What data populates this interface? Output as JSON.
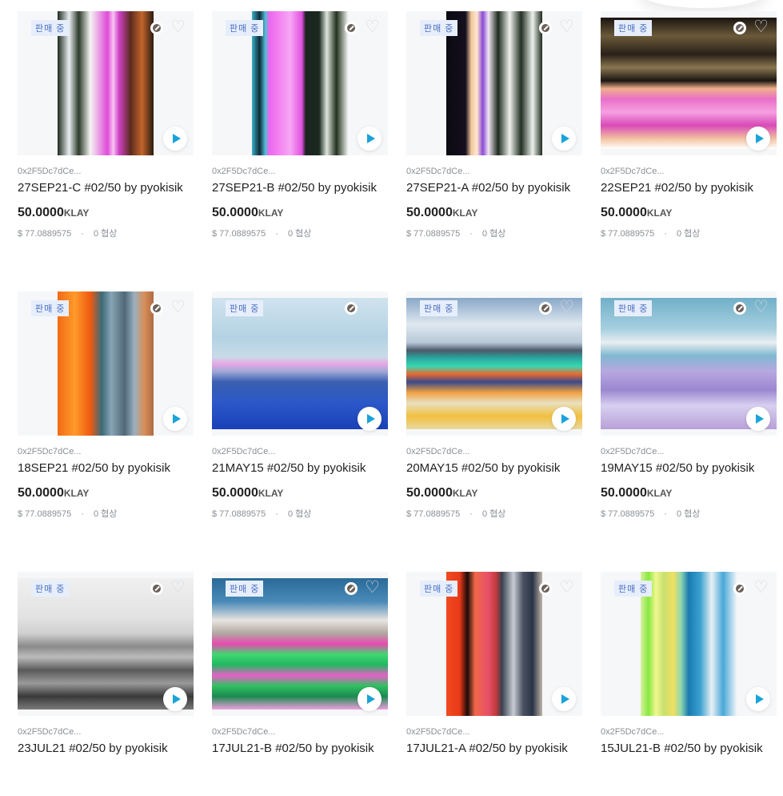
{
  "colors": {
    "accent": "#1aa3d8",
    "badge_bg": "#e7eefb",
    "badge_text": "#4a6fc1"
  },
  "icons": {
    "wish": "heart-outline-icon",
    "play": "play-icon",
    "chain": "klaytn-icon"
  },
  "cards": [
    {
      "badge": "판매 중",
      "owner": "0x2F5Dc7dCe...",
      "title": "27SEP21-C #02/50 by pyokisik",
      "price": "50.0000",
      "unit": "KLAY",
      "usd": "$ 77.0889575",
      "offers": "0 협상"
    },
    {
      "badge": "판매 중",
      "owner": "0x2F5Dc7dCe...",
      "title": "27SEP21-B #02/50 by pyokisik",
      "price": "50.0000",
      "unit": "KLAY",
      "usd": "$ 77.0889575",
      "offers": "0 협상"
    },
    {
      "badge": "판매 중",
      "owner": "0x2F5Dc7dCe...",
      "title": "27SEP21-A #02/50 by pyokisik",
      "price": "50.0000",
      "unit": "KLAY",
      "usd": "$ 77.0889575",
      "offers": "0 협상"
    },
    {
      "badge": "판매 중",
      "owner": "0x2F5Dc7dCe...",
      "title": "22SEP21 #02/50 by pyokisik",
      "price": "50.0000",
      "unit": "KLAY",
      "usd": "$ 77.0889575",
      "offers": "0 협상"
    },
    {
      "badge": "판매 중",
      "owner": "0x2F5Dc7dCe...",
      "title": "18SEP21 #02/50 by pyokisik",
      "price": "50.0000",
      "unit": "KLAY",
      "usd": "$ 77.0889575",
      "offers": "0 협상"
    },
    {
      "badge": "판매 중",
      "owner": "0x2F5Dc7dCe...",
      "title": "21MAY15 #02/50 by pyokisik",
      "price": "50.0000",
      "unit": "KLAY",
      "usd": "$ 77.0889575",
      "offers": "0 협상"
    },
    {
      "badge": "판매 중",
      "owner": "0x2F5Dc7dCe...",
      "title": "20MAY15 #02/50 by pyokisik",
      "price": "50.0000",
      "unit": "KLAY",
      "usd": "$ 77.0889575",
      "offers": "0 협상"
    },
    {
      "badge": "판매 중",
      "owner": "0x2F5Dc7dCe...",
      "title": "19MAY15 #02/50 by pyokisik",
      "price": "50.0000",
      "unit": "KLAY",
      "usd": "$ 77.0889575",
      "offers": "0 협상"
    },
    {
      "badge": "판매 중",
      "owner": "0x2F5Dc7dCe...",
      "title": "23JUL21 #02/50 by pyokisik"
    },
    {
      "badge": "판매 중",
      "owner": "0x2F5Dc7dCe...",
      "title": "17JUL21-B #02/50 by pyokisik"
    },
    {
      "badge": "판매 중",
      "owner": "0x2F5Dc7dCe...",
      "title": "17JUL21-A #02/50 by pyokisik"
    },
    {
      "badge": "판매 중",
      "owner": "0x2F5Dc7dCe...",
      "title": "15JUL21-B #02/50 by pyokisik"
    }
  ]
}
